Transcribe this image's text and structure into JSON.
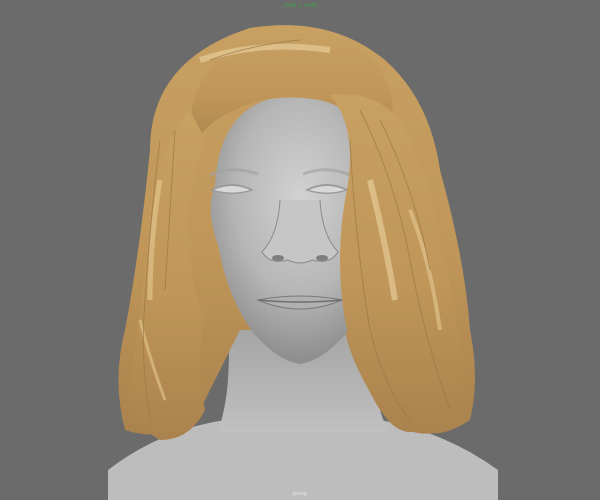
{
  "viewport": {
    "resolution_gate_label": "2048 x 2048",
    "camera_label": "persp",
    "background_color": "#6b6b6b"
  },
  "scene": {
    "subject": "3d-head-with-hair",
    "skin_color": "#b9b9b9",
    "hair_color": "#c29a5e"
  }
}
